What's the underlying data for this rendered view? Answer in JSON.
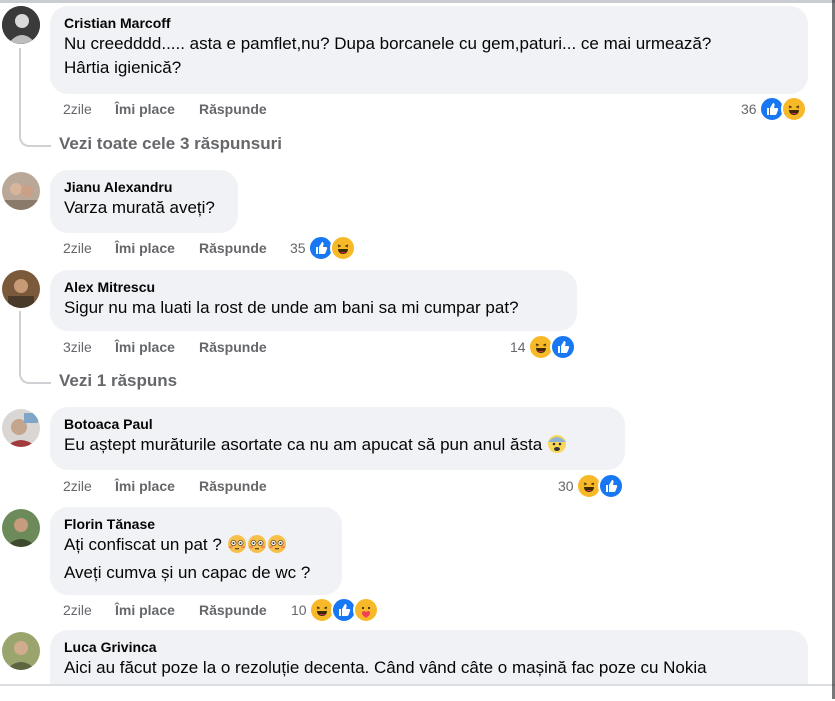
{
  "comments": [
    {
      "author": "Cristian Marcoff",
      "text_lines": [
        "Nu creedddd..... asta e pamflet,nu? Dupa borcanele cu gem,paturi... ce mai urmează?",
        "Hârtia igienică?"
      ],
      "time": "2zile",
      "like": "Îmi place",
      "reply": "Răspunde",
      "reaction_count": "36",
      "reactions": [
        "like",
        "haha"
      ],
      "replies_link": "Vezi toate cele 3 răspunsuri"
    },
    {
      "author": "Jianu Alexandru",
      "text_lines": [
        "Varza murată aveți?"
      ],
      "time": "2zile",
      "like": "Îmi place",
      "reply": "Răspunde",
      "reaction_count": "35",
      "reactions": [
        "like",
        "haha"
      ]
    },
    {
      "author": "Alex Mitrescu",
      "text_lines": [
        "Sigur nu ma luati la rost de unde am bani sa mi cumpar pat?"
      ],
      "time": "3zile",
      "like": "Îmi place",
      "reply": "Răspunde",
      "reaction_count": "14",
      "reactions": [
        "haha",
        "like"
      ],
      "replies_link": "Vezi 1 răspuns"
    },
    {
      "author": "Botoaca Paul",
      "text_lines": [
        "Eu aștept murăturile asortate ca nu am apucat să pun anul ăsta"
      ],
      "time": "2zile",
      "like": "Îmi place",
      "reply": "Răspunde",
      "reaction_count": "30",
      "reactions": [
        "haha",
        "like"
      ]
    },
    {
      "author": "Florin Tănase",
      "text_lines": [
        "Ați confiscat un pat ?",
        "Aveți cumva și un capac de wc ?"
      ],
      "time": "2zile",
      "like": "Îmi place",
      "reply": "Răspunde",
      "reaction_count": "10",
      "reactions": [
        "haha",
        "like",
        "care"
      ]
    },
    {
      "author": "Luca Grivinca",
      "text_lines": [
        "Aici au făcut poze la o rezoluție decenta. Când vând câte o mașină fac poze cu Nokia"
      ]
    }
  ],
  "colors": {
    "like": "#1877f2",
    "haha": "#f7b928",
    "bubble": "#f0f2f5",
    "meta": "#65676b"
  },
  "icons": {
    "like": "thumbs-up-icon",
    "haha": "laughing-face-icon",
    "care": "care-hug-icon",
    "fearful": "fearful-face-emoji",
    "flushed": "flushed-face-emoji"
  }
}
